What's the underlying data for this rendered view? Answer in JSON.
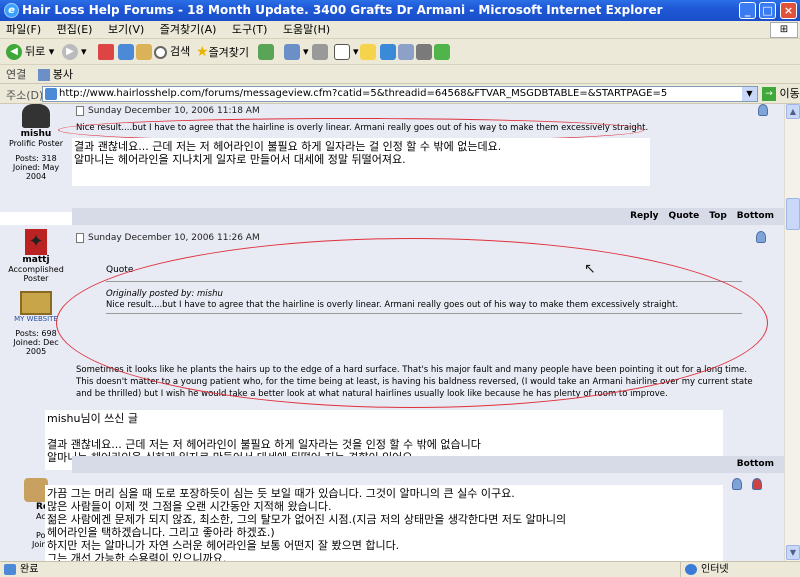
{
  "window": {
    "title": "Hair Loss Help Forums - 18 Month Update. 3400 Grafts Dr Armani - Microsoft Internet Explorer",
    "logo": "e",
    "controls": [
      "_",
      "□",
      "×"
    ]
  },
  "menu": {
    "items": [
      "파일(F)",
      "편집(E)",
      "보기(V)",
      "즐겨찾기(A)",
      "도구(T)",
      "도움말(H)"
    ]
  },
  "toolbar": {
    "back_label": "뒤로",
    "search_label": "검색",
    "favorites_label": "즐겨찾기"
  },
  "links": {
    "label": "연결",
    "item": "봉사"
  },
  "address": {
    "label": "주소(D)",
    "url": "http://www.hairlosshelp.com/forums/messageview.cfm?catid=5&threadid=64568&FTVAR_MSGDBTABLE=&STARTPAGE=5",
    "go_label": "이동"
  },
  "posts": [
    {
      "user": "mishu",
      "rank": "Prolific Poster",
      "posts": "Posts: 318",
      "joined": "Joined: May 2004",
      "date": "Sunday December 10, 2006 11:18 AM",
      "text": "Nice result....but I have to agree that the hairline is overly linear. Armani really goes out of his way to make them excessively straight.",
      "translation": "결과 괜찮네요... 근데 저는 저 헤어라인이 불필요 하게 일자라는 걸 인정 할 수 밖에 없는데요.\n알마니는 헤어라인을 지나치게 일자로 만들어서 대세에 정말 뒤떨어져요."
    },
    {
      "user": "mattj",
      "rank": "Accomplished Poster",
      "website": "MY WEBSITE",
      "posts": "Posts: 698",
      "joined": "Joined: Dec 2005",
      "date": "Sunday December 10, 2006 11:26 AM",
      "quote_title": "Quote",
      "quote_by": "Originally posted by: mishu",
      "quote_text": "Nice result....but I have to agree that the hairline is overly linear. Armani really goes out of his way to make them excessively straight.",
      "text": "Sometimes it looks like he plants the hairs up to the edge of a hard surface. That's his major fault and many people have been pointing it out for a long time. This doesn't matter to a young patient who, for the time being at least, is having his baldness reversed, (I would take an Armani hairline over my current state and be thrilled) but I wish he would take a better look at what natural hairlines usually look like because he has plenty of room to improve.",
      "translation": "mishu님이 쓰신 글\n\n결과 괜찮네요... 근데 저는 저 헤어라인이 불필요 하게 일자라는 것을 인정 할 수 밖에 없습니다\n알마니는 헤어라인을 심하게 일자로 만들어서 대세에 뒤떨어 지는 경향이 있어요.\n--------------------------------------------------------------------------------------------------------"
    },
    {
      "user": "Rodger",
      "rank": "Accom",
      "posts": "Post",
      "joined": "Joined: 2",
      "translation": "가끔 그는 머리 심을 때 도로 포장하듯이 심는 듯 보일 때가 있습니다. 그것이 알마니의 큰 실수 이구요.\n많은 사람들이 이제 껏 그점을 오랜 시간동안 지적해 왔습니다.\n젊은 사람에겐 문제가 되지 않죠, 최소한, 그의 탈모가 없어진 시점.(지금 저의 상태만을 생각한다면 저도 알마니의\n헤어라인을 택하겠습니다. 그리고 좋아라 하겠죠.)\n하지만 저는 알마니가 자연 스러운 헤어라인을 보통 어떤지 잘 봤으면 합니다.\n그는 개선 가능한 수용력이 있으니까요."
    }
  ],
  "post_actions": [
    "Reply",
    "Quote",
    "Top",
    "Bottom"
  ],
  "status": {
    "text": "완료",
    "zone": "인터넷"
  }
}
